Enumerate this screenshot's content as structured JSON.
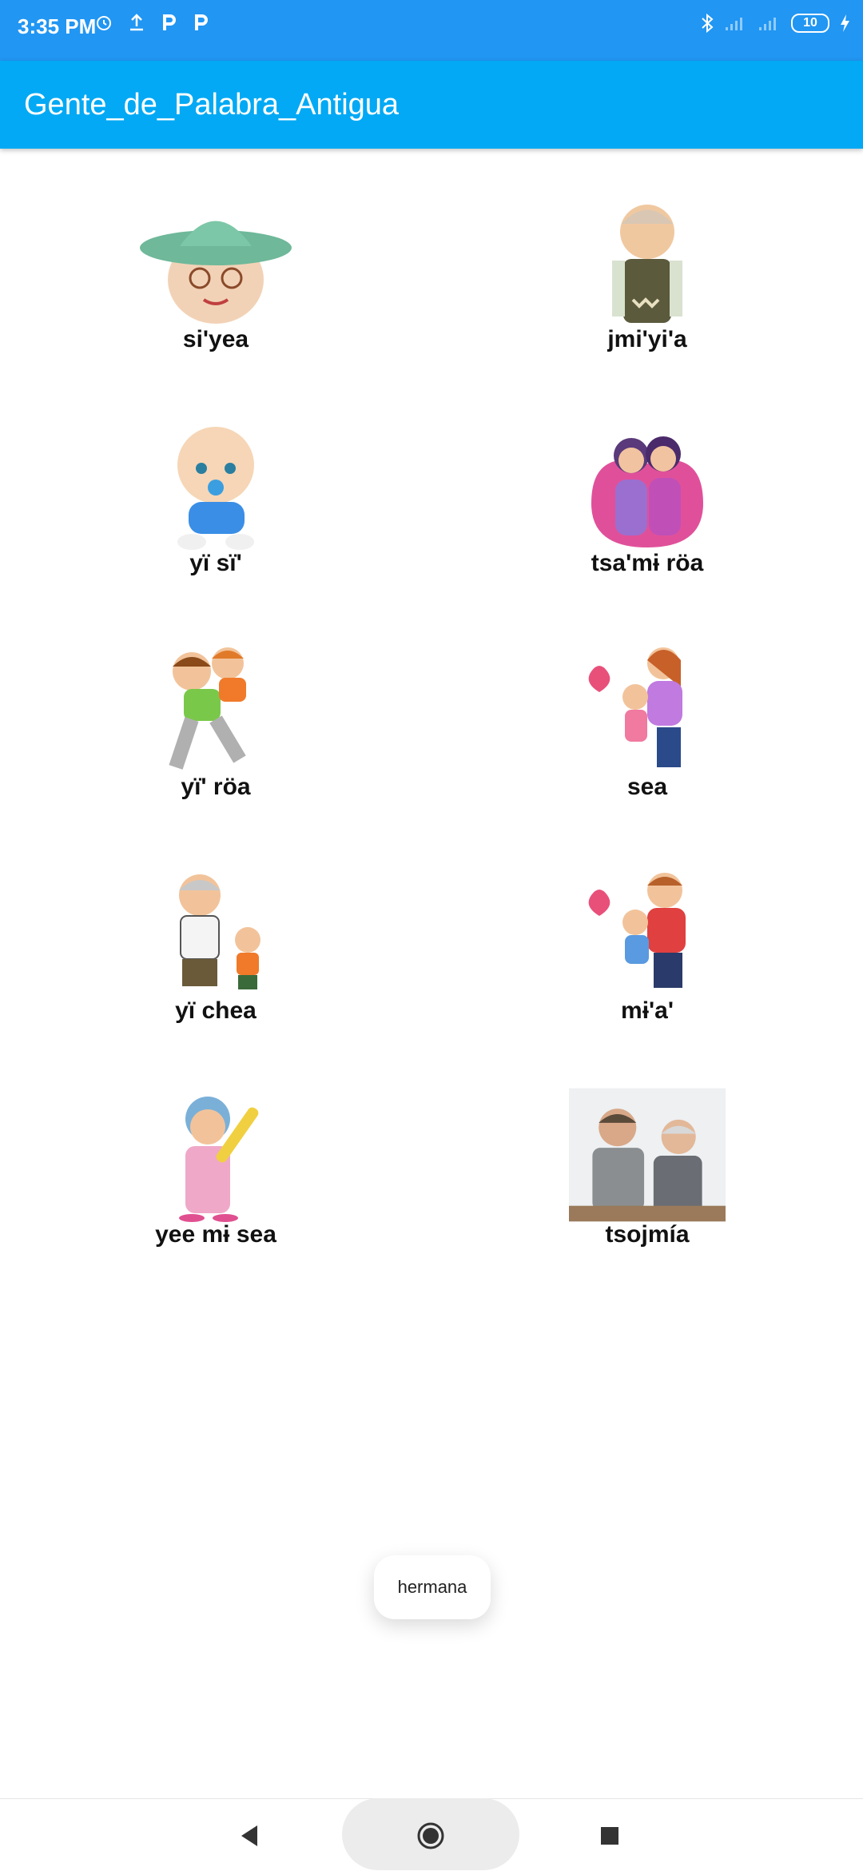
{
  "status_bar": {
    "time": "3:35 PM",
    "battery": "10",
    "left_icons": [
      "alarm-icon",
      "upload-icon",
      "p-app-icon",
      "p-app-icon"
    ],
    "right_icons": [
      "bluetooth-icon",
      "signal-icon",
      "signal-icon",
      "battery-icon",
      "charging-icon"
    ]
  },
  "app_bar": {
    "title": "Gente_de_Palabra_Antigua"
  },
  "items": [
    {
      "label": "si'yea",
      "icon": "grandmother-hat-image"
    },
    {
      "label": "jmi'yi'a",
      "icon": "grandfather-image"
    },
    {
      "label": "yï sï'",
      "icon": "baby-image"
    },
    {
      "label": "tsa'mɨ röa",
      "icon": "sisters-image"
    },
    {
      "label": "yï' röa",
      "icon": "brothers-image"
    },
    {
      "label": "sea",
      "icon": "mother-daughter-image"
    },
    {
      "label": "yï chea",
      "icon": "grandfather-grandson-image"
    },
    {
      "label": "mɨ'a'",
      "icon": "father-child-image"
    },
    {
      "label": "yee mɨ sea",
      "icon": "grandmother-rolling-pin-image"
    },
    {
      "label": "tsojmía",
      "icon": "father-elder-son-image"
    }
  ],
  "toast": {
    "text": "hermana"
  },
  "nav": {
    "icons": [
      "back-icon",
      "home-icon",
      "recents-icon"
    ]
  },
  "colors": {
    "status_bar": "#2196F3",
    "app_bar": "#03A9F4"
  }
}
